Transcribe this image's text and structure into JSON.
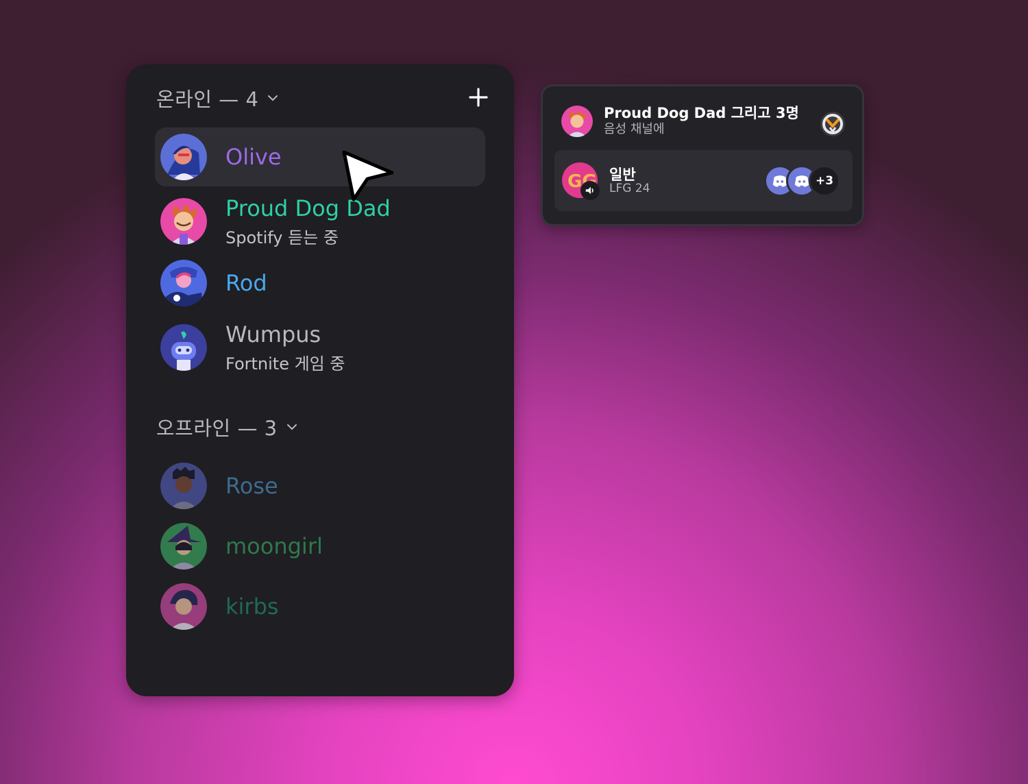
{
  "friends_panel": {
    "online_header": "온라인 — 4",
    "offline_header": "오프라인 — 3",
    "online": [
      {
        "name": "Olive",
        "status": "",
        "color": "#9b6be8"
      },
      {
        "name": "Proud Dog Dad",
        "status": "Spotify 듣는 중",
        "color": "#2fd0a7"
      },
      {
        "name": "Rod",
        "status": "",
        "color": "#4aa8f0"
      },
      {
        "name": "Wumpus",
        "status": "Fortnite 게임 중",
        "color": "#b9b9c0"
      }
    ],
    "offline": [
      {
        "name": "Rose",
        "color": "#3d6b8f"
      },
      {
        "name": "moongirl",
        "color": "#2e7a4c"
      },
      {
        "name": "kirbs",
        "color": "#216a52"
      }
    ]
  },
  "voice_popup": {
    "title": "Proud Dog Dad 그리고 3명",
    "subtitle": "음성 채널에",
    "channel_name": "일반",
    "channel_sub": "LFG 24",
    "more_count": "+3"
  },
  "icons": {
    "add": "plus-icon",
    "chevron": "chevron-down-icon",
    "game": "overwatch-icon",
    "speaker": "speaker-icon",
    "member": "discord-icon"
  }
}
